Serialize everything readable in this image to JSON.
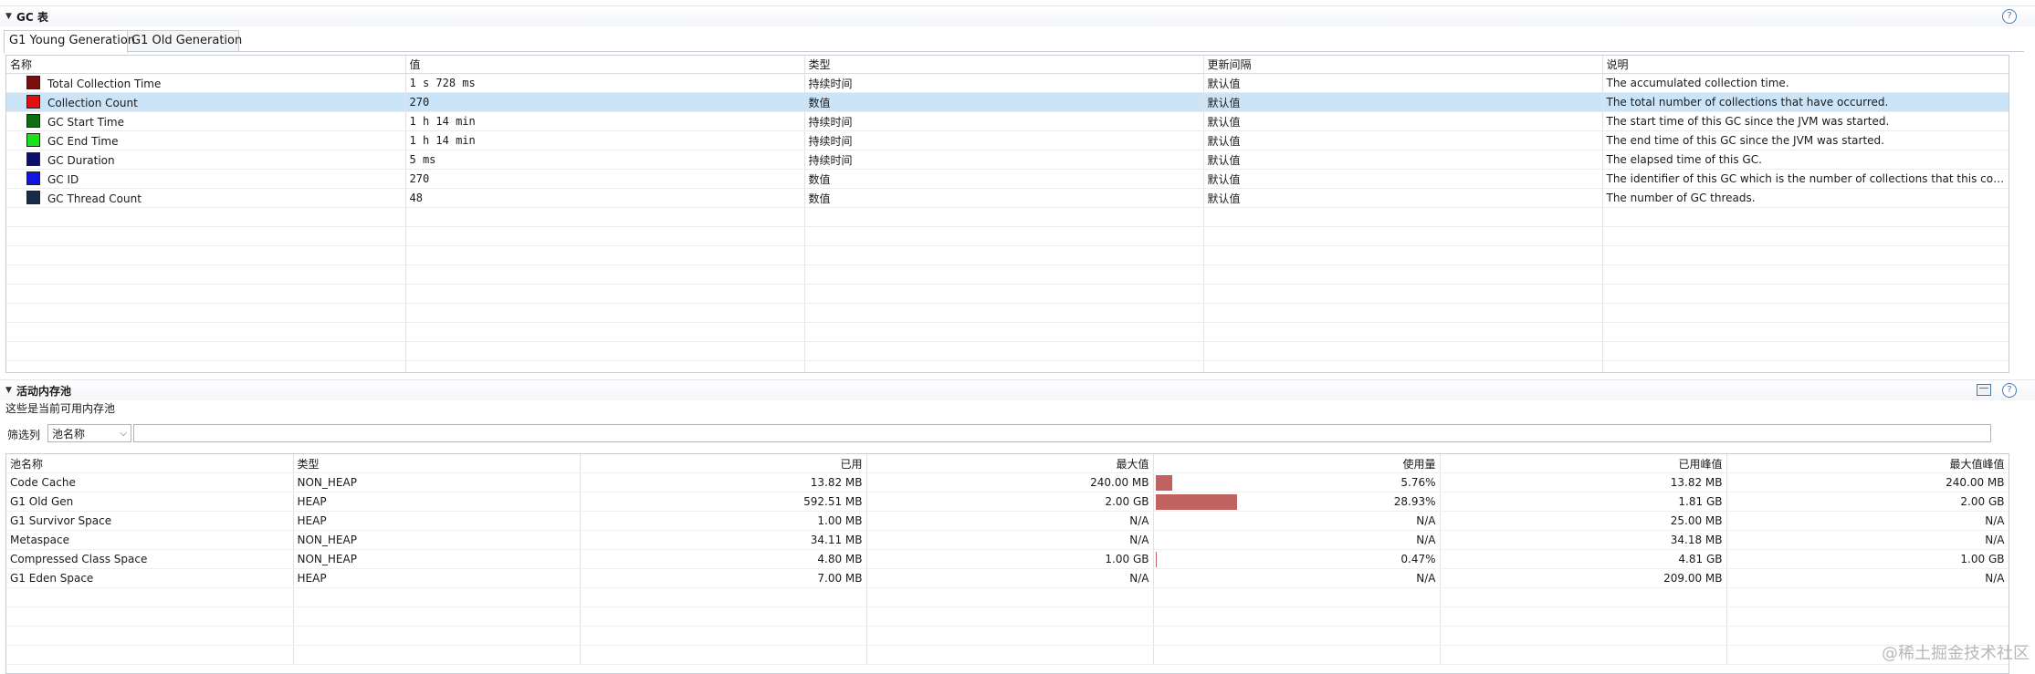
{
  "gc_section": {
    "title": "GC 表",
    "help_icon": "?",
    "tabs": [
      "G1 Young Generation",
      "G1 Old Generation"
    ],
    "columns": [
      "名称",
      "值",
      "类型",
      "更新间隔",
      "说明"
    ],
    "rows": [
      {
        "name": "Total Collection Time",
        "color": "#7a0f0f",
        "value": "1 s 728 ms",
        "type": "持续时间",
        "interval": "默认值",
        "desc": "The accumulated collection time."
      },
      {
        "name": "Collection Count",
        "color": "#e01010",
        "value": "270",
        "type": "数值",
        "interval": "默认值",
        "desc": "The total number of collections that have occurred."
      },
      {
        "name": "GC Start Time",
        "color": "#0f6e12",
        "value": "1 h 14 min",
        "type": "持续时间",
        "interval": "默认值",
        "desc": "The start time of this GC since the JVM was started."
      },
      {
        "name": "GC End Time",
        "color": "#1be01b",
        "value": "1 h 14 min",
        "type": "持续时间",
        "interval": "默认值",
        "desc": "The end time of this GC since the JVM was started."
      },
      {
        "name": "GC Duration",
        "color": "#0c0e6e",
        "value": "5 ms",
        "type": "持续时间",
        "interval": "默认值",
        "desc": "The elapsed time of this GC."
      },
      {
        "name": "GC ID",
        "color": "#1414e0",
        "value": "270",
        "type": "数值",
        "interval": "默认值",
        "desc": "The identifier of this GC which is the number of collections that this colle..."
      },
      {
        "name": "GC Thread Count",
        "color": "#1a2b4a",
        "value": "48",
        "type": "数值",
        "interval": "默认值",
        "desc": "The number of GC threads."
      }
    ]
  },
  "pool_section": {
    "title": "活动内存池",
    "description": "这些是当前可用内存池",
    "filter_label": "筛选列",
    "filter_select": "池名称",
    "filter_value": "",
    "columns": [
      "池名称",
      "类型",
      "已用",
      "最大值",
      "使用量",
      "已用峰值",
      "最大值峰值"
    ],
    "rows": [
      {
        "name": "Code Cache",
        "type": "NON_HEAP",
        "used": "13.82 MB",
        "max": "240.00 MB",
        "usage": "5.76%",
        "usage_fraction": 0.0576,
        "peak_used": "13.82 MB",
        "peak_max": "240.00 MB"
      },
      {
        "name": "G1 Old Gen",
        "type": "HEAP",
        "used": "592.51 MB",
        "max": "2.00 GB",
        "usage": "28.93%",
        "usage_fraction": 0.2893,
        "peak_used": "1.81 GB",
        "peak_max": "2.00 GB"
      },
      {
        "name": "G1 Survivor Space",
        "type": "HEAP",
        "used": "1.00 MB",
        "max": "N/A",
        "usage": "N/A",
        "usage_fraction": 0,
        "peak_used": "25.00 MB",
        "peak_max": "N/A"
      },
      {
        "name": "Metaspace",
        "type": "NON_HEAP",
        "used": "34.11 MB",
        "max": "N/A",
        "usage": "N/A",
        "usage_fraction": 0,
        "peak_used": "34.18 MB",
        "peak_max": "N/A"
      },
      {
        "name": "Compressed Class Space",
        "type": "NON_HEAP",
        "used": "4.80 MB",
        "max": "1.00 GB",
        "usage": "0.47%",
        "usage_fraction": 0.0047,
        "peak_used": "4.81 GB",
        "peak_max": "1.00 GB"
      },
      {
        "name": "G1 Eden Space",
        "type": "HEAP",
        "used": "7.00 MB",
        "max": "N/A",
        "usage": "N/A",
        "usage_fraction": 0,
        "peak_used": "209.00 MB",
        "peak_max": "N/A"
      }
    ]
  },
  "watermark": "@稀土掘金技术社区"
}
